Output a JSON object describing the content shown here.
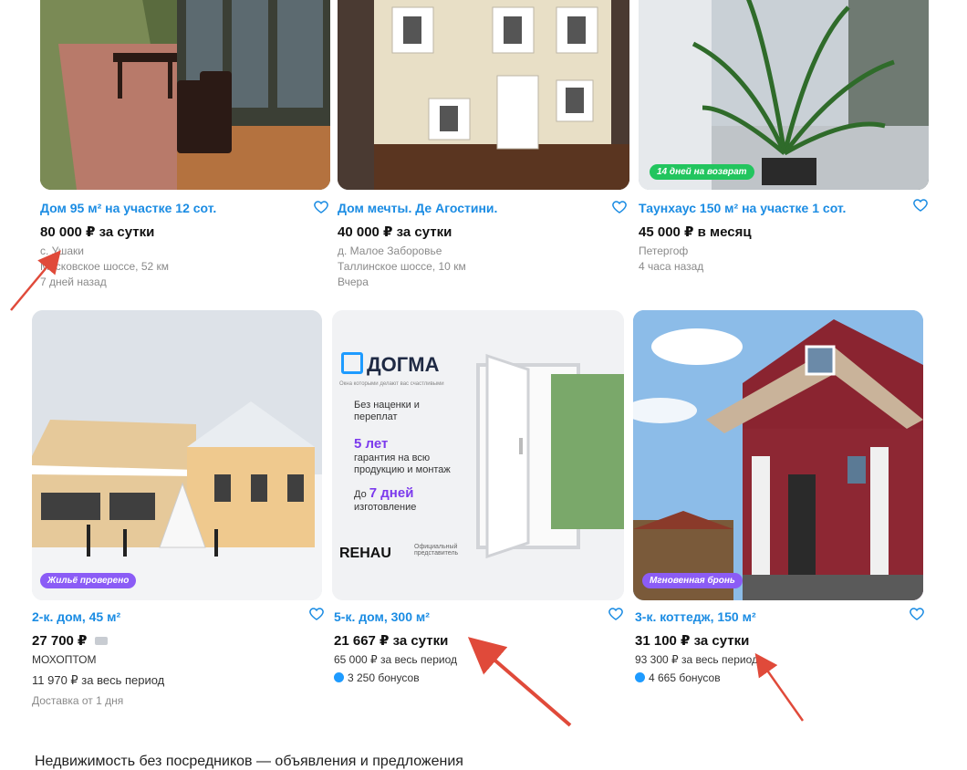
{
  "listings": [
    {
      "title": "Дом 95 м² на участке 12 сот.",
      "price": "80 000 ₽ за сутки",
      "lines": [
        "с. Ушаки",
        "Московское шоссе, 52 км",
        "7 дней назад"
      ]
    },
    {
      "title": "Дом мечты. Де Агостини.",
      "price": "40 000 ₽ за сутки",
      "lines": [
        "д. Малое Заборовье",
        "Таллинское шоссе, 10 км",
        "Вчера"
      ]
    },
    {
      "title": "Таунхаус 150 м² на участке 1 сот.",
      "price": "45 000 ₽ в месяц",
      "badge": "14 дней на возврат",
      "lines": [
        "Петергоф",
        "4 часа назад"
      ]
    },
    {
      "title": "2-к. дом, 45 м²",
      "price": "27 700 ₽",
      "badge": "Жильё проверено",
      "lines": [
        "МОХОПТОМ",
        "11 970 ₽ за весь период",
        "Доставка от 1 дня"
      ]
    },
    {
      "title": "5-к. дом, 300 м²",
      "price": "21 667 ₽ за сутки",
      "lines": [
        "65 000 ₽ за весь период"
      ],
      "bonus": "3 250 бонусов",
      "ad": {
        "brand": "ДОГМА",
        "tagline": "Окна которыми делают вас счастливыми",
        "feature1": "Без наценки и переплат",
        "feature2_big": "5 лет",
        "feature2": "гарантия на всю продукцию и монтаж",
        "feature3_prefix": "До",
        "feature3_big": "7 дней",
        "feature3": "изготовление",
        "partner": "REHAU",
        "partner_note": "Официальный представитель"
      }
    },
    {
      "title": "3-к. коттедж, 150 м²",
      "price": "31 100 ₽ за сутки",
      "badge": "Мгновенная бронь",
      "lines": [
        "93 300 ₽ за весь период"
      ],
      "bonus": "4 665 бонусов"
    }
  ],
  "footer_text": "Недвижимость без посредников — объявления и предложения",
  "colors": {
    "title_blue": "#1b8ce3",
    "badge_green": "#22c55e",
    "badge_purple": "#8b5cf6",
    "arrow_red": "#e04a3a"
  }
}
